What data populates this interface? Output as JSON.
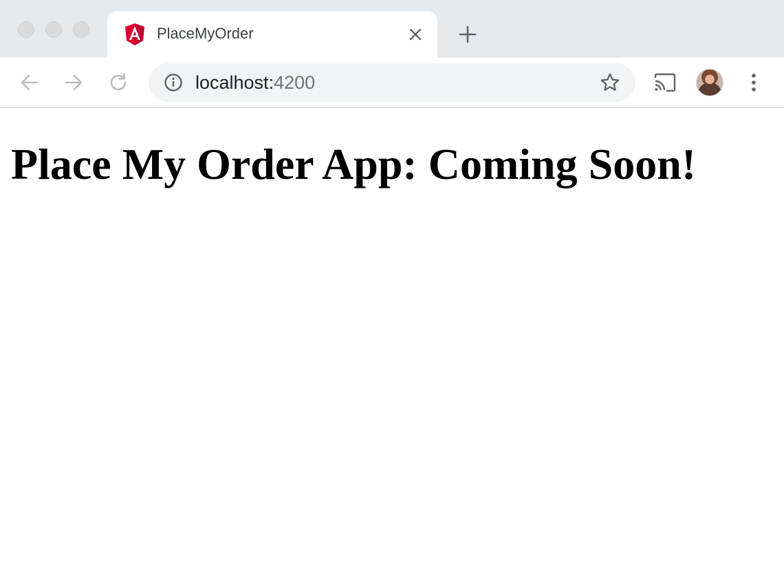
{
  "browser": {
    "tab": {
      "title": "PlaceMyOrder",
      "favicon_icon": "angular-logo-icon"
    },
    "address_bar": {
      "host": "localhost:",
      "port": "4200"
    },
    "icons": {
      "back": "arrow-left-icon",
      "forward": "arrow-right-icon",
      "reload": "reload-icon",
      "site_info": "info-circle-icon",
      "bookmark": "star-icon",
      "cast": "cast-icon",
      "menu": "vertical-dots-icon",
      "new_tab": "plus-icon",
      "close_tab": "close-icon"
    }
  },
  "page": {
    "heading": "Place My Order App: Coming Soon!"
  },
  "colors": {
    "tabstrip_bg": "#e6e9ec",
    "omnibox_bg": "#f1f3f4",
    "angular_red": "#dd0031",
    "angular_dark_red": "#c3002f"
  }
}
